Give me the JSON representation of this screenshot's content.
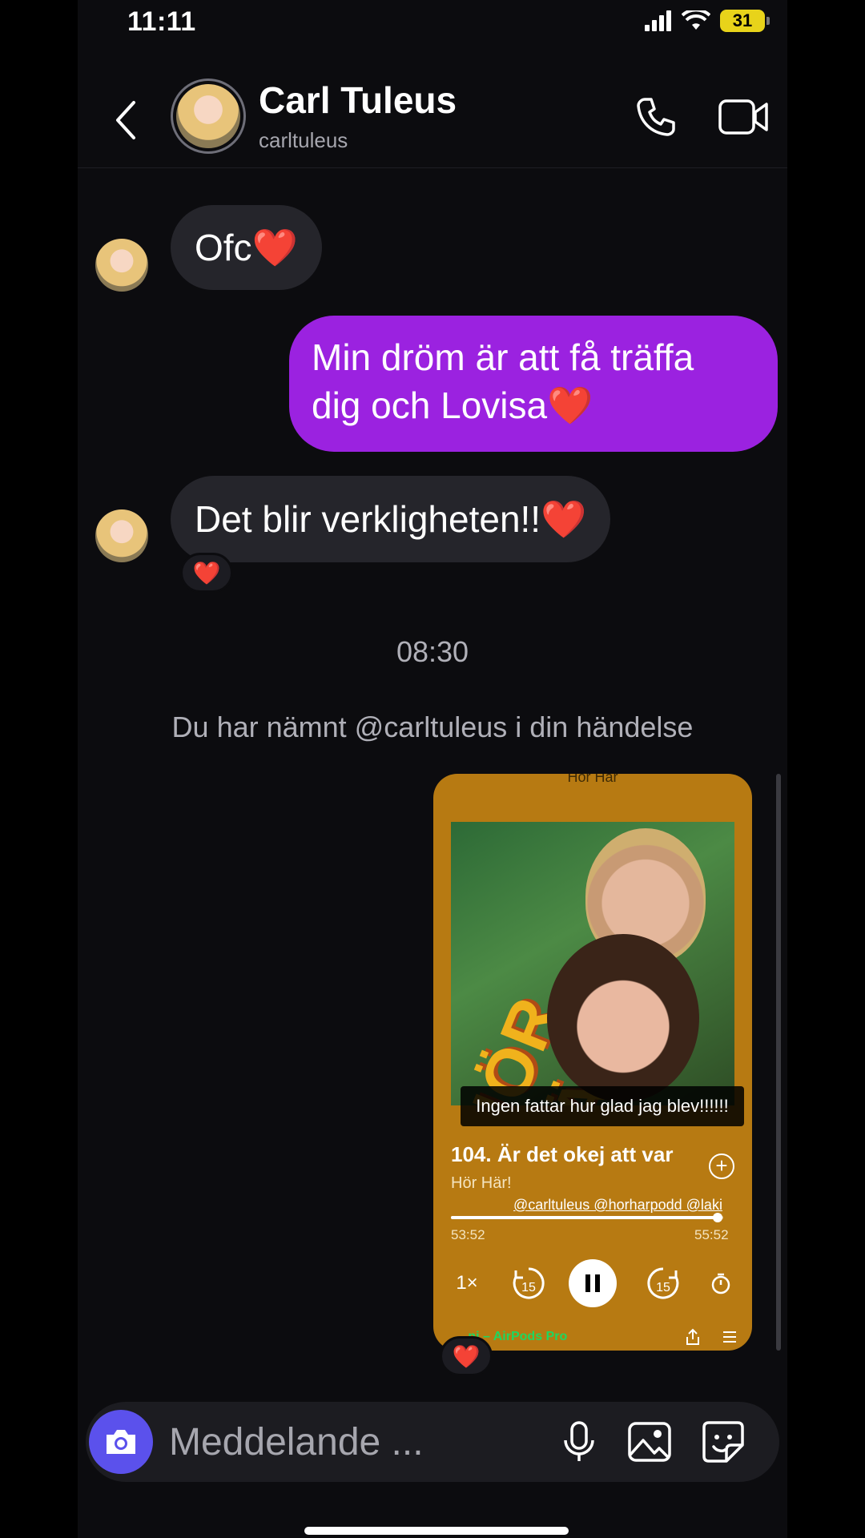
{
  "status_bar": {
    "time": "11:11",
    "battery": "31"
  },
  "header": {
    "name": "Carl Tuleus",
    "handle": "carltuleus"
  },
  "messages": [
    {
      "from": "them",
      "text": "Ofc",
      "emoji": "❤️"
    },
    {
      "from": "me",
      "line1": "Min dröm är att få träffa",
      "line2": "dig och Lovisa",
      "emoji": "❤️"
    },
    {
      "from": "them",
      "text": "Det blir verkligheten!!",
      "emoji": "❤️",
      "reaction": "❤️"
    }
  ],
  "timestamp": "08:30",
  "system_note": "Du har nämnt @carltuleus i din händelse",
  "story": {
    "top_label": "Hör Här",
    "cover_title": "HÖR HÄR!",
    "caption": "Ingen fattar hur glad jag blev!!!!!!",
    "episode_title": "104. Är det okej att var",
    "show": "Hör Här!",
    "mentions": "@carltuleus @horharpodd @laki",
    "elapsed": "53:52",
    "total": "55:52",
    "progress": 0.98,
    "speed": "1×",
    "rewind": "15",
    "forward": "15",
    "device": "...ni – AirPods Pro",
    "reaction": "❤️"
  },
  "composer": {
    "placeholder": "Meddelande ..."
  },
  "colors": {
    "outgoing_bubble": "#9b22e0",
    "incoming_bubble": "#25252b",
    "camera_button": "#5b51ec",
    "story_bg": "#b77a12"
  }
}
